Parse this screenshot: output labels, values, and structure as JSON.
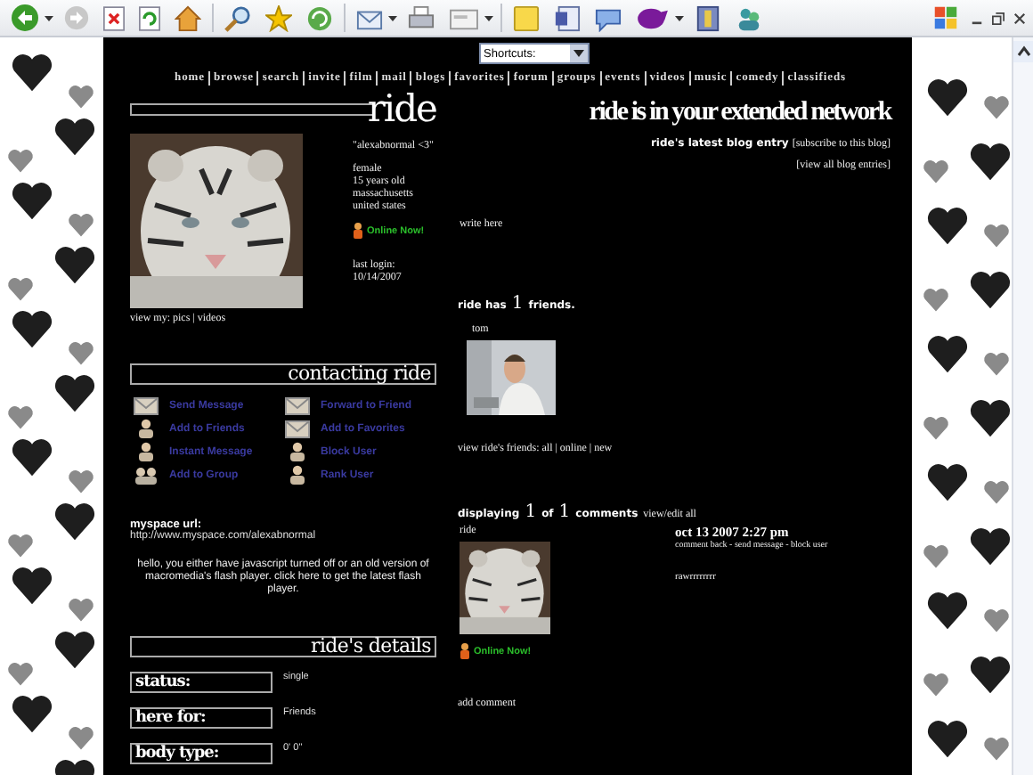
{
  "shortcuts": {
    "value": "Shortcuts:"
  },
  "nav": [
    "home",
    "browse",
    "search",
    "invite",
    "film",
    "mail",
    "blogs",
    "favorites",
    "forum",
    "groups",
    "events",
    "videos",
    "music",
    "comedy",
    "classifieds"
  ],
  "profile": {
    "heading": "ride",
    "quote": "\"alexabnormal <3\"",
    "details": [
      "female",
      "15 years old",
      "massachusetts",
      "united states"
    ],
    "online": "Online Now!",
    "last_login_label": "last login:",
    "last_login": "10/14/2007",
    "view_my": "view my: pics | videos"
  },
  "contacting": {
    "heading": "contacting ride",
    "actions": [
      {
        "label": "Send Message"
      },
      {
        "label": "Forward to Friend"
      },
      {
        "label": "Add to Friends"
      },
      {
        "label": "Add to Favorites"
      },
      {
        "label": "Instant Message"
      },
      {
        "label": "Block User"
      },
      {
        "label": "Add to Group"
      },
      {
        "label": "Rank User"
      }
    ]
  },
  "url": {
    "label": "myspace url:",
    "value": "http://www.myspace.com/alexabnormal"
  },
  "flash_notice": "hello, you either have javascript turned off or an old version of macromedia's flash player. click here to get the latest flash player.",
  "details": {
    "heading": "ride's details",
    "rows": [
      {
        "label": "status:",
        "value": "single"
      },
      {
        "label": "here for:",
        "value": "Friends"
      },
      {
        "label": "body type:",
        "value": "0' 0\""
      }
    ]
  },
  "extended_network": "ride is in your extended network",
  "blog": {
    "title": "ride's latest blog entry",
    "subscribe": "[subscribe to this blog]",
    "view_all": "[view all blog entries]"
  },
  "about": "write here",
  "friends": {
    "prefix": "ride has",
    "count": "1",
    "suffix": "friends.",
    "items": [
      {
        "name": "tom"
      }
    ],
    "view": "view ride's friends: all | online | new"
  },
  "comments": {
    "prefix": "displaying",
    "shown": "1",
    "of": "of",
    "total": "1",
    "suffix": "comments",
    "view_edit": "view/edit all",
    "items": [
      {
        "author": "ride",
        "online": "Online Now!",
        "date": "oct 13 2007 2:27 pm",
        "actions": "comment back - send message - block user",
        "text": "rawrrrrrrrr"
      }
    ],
    "add": "add comment"
  }
}
